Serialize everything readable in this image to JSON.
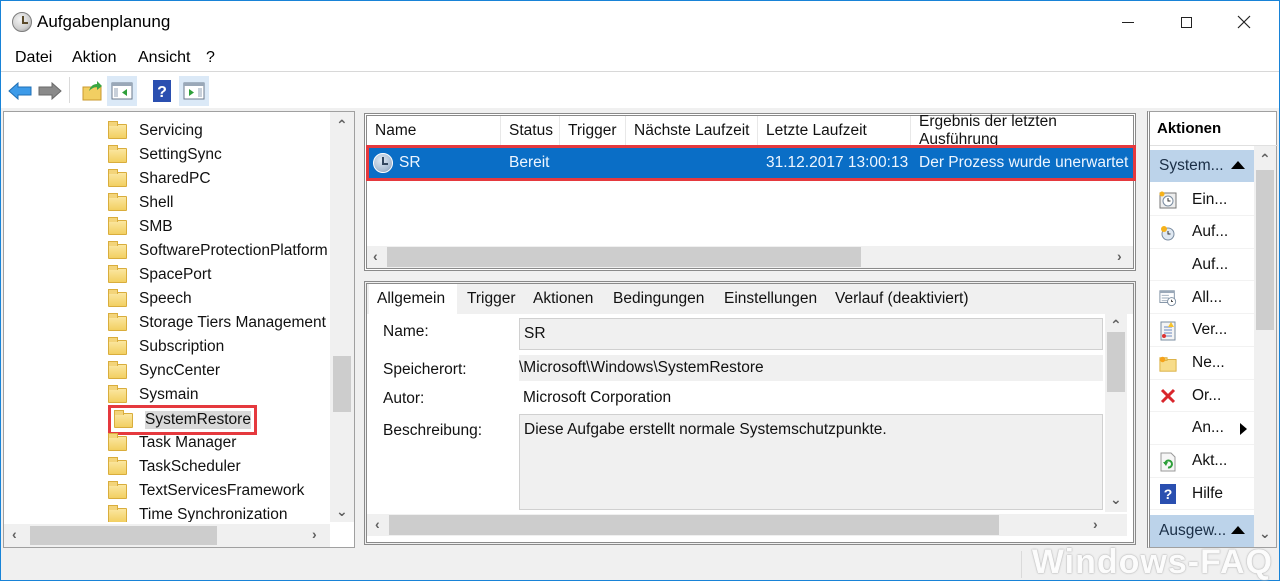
{
  "window": {
    "title": "Aufgabenplanung",
    "controls": {
      "minimize": "minimize",
      "maximize": "maximize",
      "close": "close"
    }
  },
  "menu": [
    "Datei",
    "Aktion",
    "Ansicht",
    "?"
  ],
  "toolbar": {
    "buttons": [
      {
        "name": "back",
        "icon": "arrow-left-icon"
      },
      {
        "name": "forward",
        "icon": "arrow-right-icon"
      },
      {
        "name": "up-folder",
        "icon": "folder-up-icon"
      },
      {
        "name": "show-hide-console-tree",
        "icon": "console-tree-icon",
        "pressed": true
      },
      {
        "name": "help",
        "icon": "help-icon"
      },
      {
        "name": "show-hide-action-pane",
        "icon": "action-pane-icon",
        "pressed": true
      }
    ]
  },
  "tree": {
    "items": [
      "Servicing",
      "SettingSync",
      "SharedPC",
      "Shell",
      "SMB",
      "SoftwareProtectionPlatform",
      "SpacePort",
      "Speech",
      "Storage Tiers Management",
      "Subscription",
      "SyncCenter",
      "Sysmain",
      "SystemRestore",
      "Task Manager",
      "TaskScheduler",
      "TextServicesFramework",
      "Time Synchronization"
    ],
    "selected": "SystemRestore",
    "highlight_color": "#e5393e"
  },
  "task_list": {
    "columns": [
      "Name",
      "Status",
      "Trigger",
      "Nächste Laufzeit",
      "Letzte Laufzeit",
      "Ergebnis der letzten Ausführung"
    ],
    "rows": [
      {
        "name": "SR",
        "status": "Bereit",
        "trigger": "",
        "next_run": "",
        "last_run": "31.12.2017 13:00:13",
        "result": "Der Prozess wurde unerwartet b"
      }
    ],
    "selected_color": "#0a6ec6"
  },
  "details": {
    "tabs": [
      "Allgemein",
      "Trigger",
      "Aktionen",
      "Bedingungen",
      "Einstellungen",
      "Verlauf (deaktiviert)"
    ],
    "active_tab": "Allgemein",
    "fields": {
      "name_label": "Name:",
      "name_value": "SR",
      "location_label": "Speicherort:",
      "location_value": "\\Microsoft\\Windows\\SystemRestore",
      "author_label": "Autor:",
      "author_value": "Microsoft Corporation",
      "description_label": "Beschreibung:",
      "description_value": "Diese Aufgabe erstellt normale Systemschutzpunkte."
    }
  },
  "actions": {
    "header": "Aktionen",
    "group1": "System...",
    "items": [
      {
        "label": "Ein...",
        "icon": "create-task-icon"
      },
      {
        "label": "Auf...",
        "icon": "create-basic-task-icon"
      },
      {
        "label": "Auf...",
        "icon": ""
      },
      {
        "label": "All...",
        "icon": "show-running-tasks-icon"
      },
      {
        "label": "Ver...",
        "icon": "enable-history-icon"
      },
      {
        "label": "Ne...",
        "icon": "new-folder-icon"
      },
      {
        "label": "Or...",
        "icon": "delete-folder-icon"
      },
      {
        "label": "An...",
        "icon": "",
        "submenu": true
      },
      {
        "label": "Akt...",
        "icon": "refresh-icon"
      },
      {
        "label": "Hilfe",
        "icon": "help-icon"
      }
    ],
    "group2": "Ausgew..."
  },
  "watermark": "Windows-FAQ"
}
